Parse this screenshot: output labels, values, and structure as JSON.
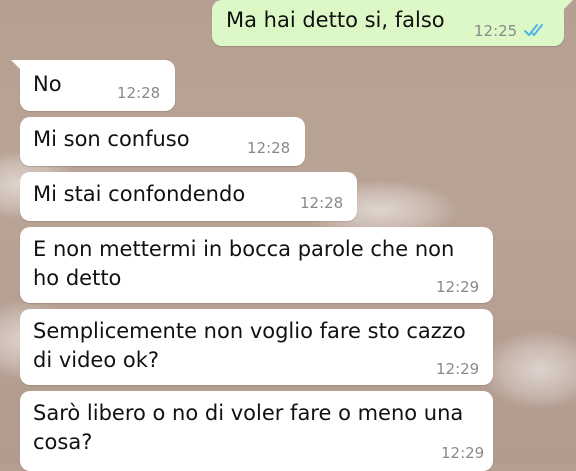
{
  "colors": {
    "incoming_bubble": "#ffffff",
    "outgoing_bubble": "#dcf8c6",
    "read_ticks": "#4fb5e8",
    "timestamp": "#8a8a8a"
  },
  "messages": [
    {
      "direction": "out",
      "text": "Ma hai detto si, falso",
      "time": "12:25",
      "status_icon": "double-check-read-icon"
    },
    {
      "direction": "in",
      "text": "No",
      "time": "12:28"
    },
    {
      "direction": "in",
      "text": "Mi son confuso",
      "time": "12:28"
    },
    {
      "direction": "in",
      "text": "Mi stai confondendo",
      "time": "12:28"
    },
    {
      "direction": "in",
      "text": "E non mettermi in bocca parole che non ho detto",
      "time": "12:29"
    },
    {
      "direction": "in",
      "text": "Semplicemente non voglio fare sto cazzo di video ok?",
      "time": "12:29"
    },
    {
      "direction": "in",
      "text": "Sarò libero o no di voler fare o meno una cosa?",
      "time": "12:29"
    }
  ]
}
